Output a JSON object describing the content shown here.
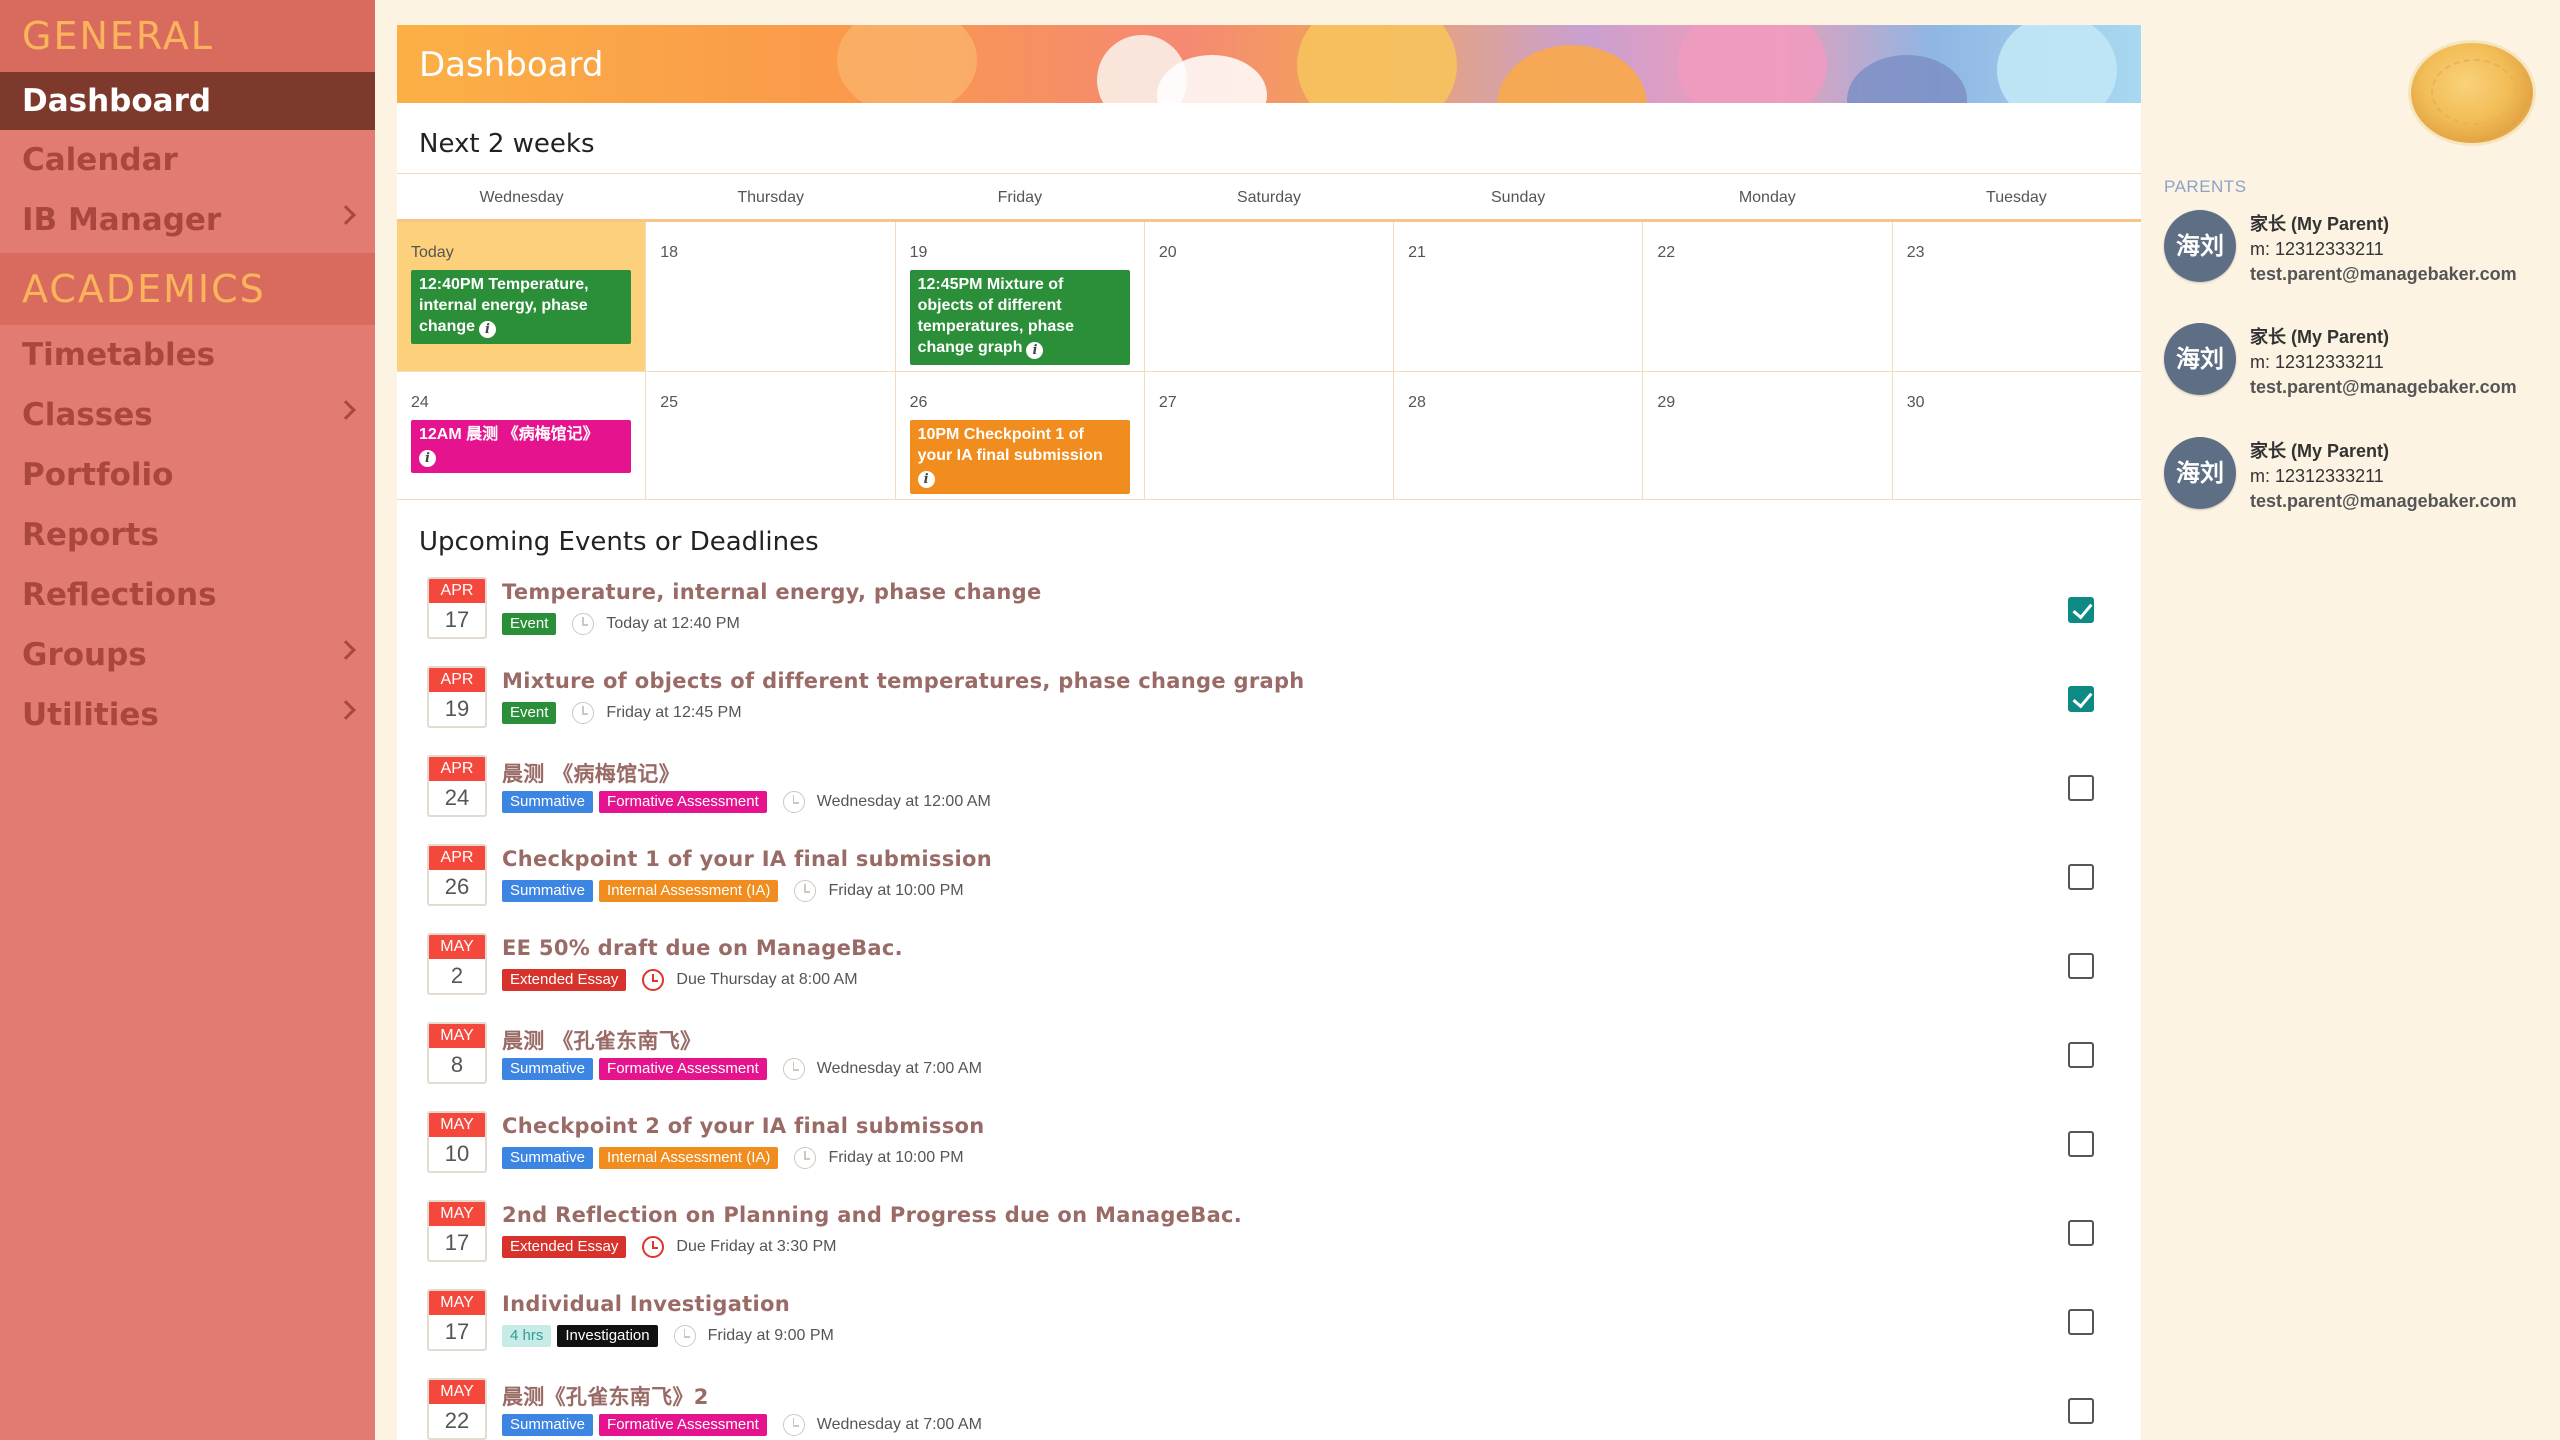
{
  "sidebar": {
    "sections": [
      {
        "title": "GENERAL"
      },
      {
        "title": "ACADEMICS"
      }
    ],
    "general_items": [
      {
        "label": "Dashboard",
        "active": true
      },
      {
        "label": "Calendar"
      },
      {
        "label": "IB Manager",
        "chevron": true
      }
    ],
    "academic_items": [
      {
        "label": "Timetables"
      },
      {
        "label": "Classes",
        "chevron": true
      },
      {
        "label": "Portfolio"
      },
      {
        "label": "Reports"
      },
      {
        "label": "Reflections"
      },
      {
        "label": "Groups",
        "chevron": true
      },
      {
        "label": "Utilities",
        "chevron": true
      }
    ]
  },
  "header": {
    "title": "Dashboard"
  },
  "calendar": {
    "title": "Next 2 weeks",
    "weekdays": [
      "Wednesday",
      "Thursday",
      "Friday",
      "Saturday",
      "Sunday",
      "Monday",
      "Tuesday"
    ],
    "week1": [
      "Today",
      "18",
      "19",
      "20",
      "21",
      "22",
      "23"
    ],
    "week2": [
      "24",
      "25",
      "26",
      "27",
      "28",
      "29",
      "30"
    ],
    "events": {
      "today": "12:40PM Temperature, internal energy, phase change",
      "d19": "12:45PM Mixture of objects of different temperatures, phase change graph",
      "d24": "12AM 晨测 《病梅馆记》",
      "d26": "10PM Checkpoint 1 of your IA final submission"
    },
    "event_colors": {
      "green": "#2b8f3a",
      "pink": "#e5148e",
      "orange": "#f08d1e"
    }
  },
  "upcoming": {
    "title": "Upcoming Events or Deadlines",
    "items": [
      {
        "month": "APR",
        "day": "17",
        "name": "Temperature, internal energy, phase change",
        "tags": [
          "Event"
        ],
        "when": "Today at 12:40 PM",
        "checked": true
      },
      {
        "month": "APR",
        "day": "19",
        "name": "Mixture of objects of different temperatures, phase change graph",
        "tags": [
          "Event"
        ],
        "when": "Friday at 12:45 PM",
        "checked": true
      },
      {
        "month": "APR",
        "day": "24",
        "name": "晨测 《病梅馆记》",
        "tags": [
          "Summative",
          "Formative Assessment"
        ],
        "when": "Wednesday at 12:00 AM",
        "checked": false
      },
      {
        "month": "APR",
        "day": "26",
        "name": "Checkpoint 1 of your IA final submission",
        "tags": [
          "Summative",
          "Internal Assessment (IA)"
        ],
        "when": "Friday at 10:00 PM",
        "checked": false
      },
      {
        "month": "MAY",
        "day": "2",
        "name": "EE 50% draft due on ManageBac.",
        "tags": [
          "Extended Essay"
        ],
        "when": "Due Thursday at 8:00 AM",
        "checked": false
      },
      {
        "month": "MAY",
        "day": "8",
        "name": "晨测 《孔雀东南飞》",
        "tags": [
          "Summative",
          "Formative Assessment"
        ],
        "when": "Wednesday at 7:00 AM",
        "checked": false
      },
      {
        "month": "MAY",
        "day": "10",
        "name": "Checkpoint 2 of your IA final submisson",
        "tags": [
          "Summative",
          "Internal Assessment (IA)"
        ],
        "when": "Friday at 10:00 PM",
        "checked": false
      },
      {
        "month": "MAY",
        "day": "17",
        "name": "2nd Reflection on Planning and Progress due on ManageBac.",
        "tags": [
          "Extended Essay"
        ],
        "when": "Due Friday at 3:30 PM",
        "checked": false
      },
      {
        "month": "MAY",
        "day": "17",
        "name": "Individual Investigation",
        "tags": [
          "4 hrs",
          "Investigation"
        ],
        "when": "Friday at 9:00 PM",
        "checked": false
      },
      {
        "month": "MAY",
        "day": "22",
        "name": "晨测《孔雀东南飞》2",
        "tags": [
          "Summative",
          "Formative Assessment"
        ],
        "when": "Wednesday at 7:00 AM",
        "checked": false
      }
    ]
  },
  "parents": {
    "label": "PARENTS",
    "list": [
      {
        "avatar": "海刘",
        "name": "家长 (My Parent)",
        "phone": "m: 12312333211",
        "email": "test.parent@managebaker.com"
      },
      {
        "avatar": "海刘",
        "name": "家长 (My Parent)",
        "phone": "m: 12312333211",
        "email": "test.parent@managebaker.com"
      },
      {
        "avatar": "海刘",
        "name": "家长 (My Parent)",
        "phone": "m: 12312333211",
        "email": "test.parent@managebaker.com"
      }
    ]
  }
}
